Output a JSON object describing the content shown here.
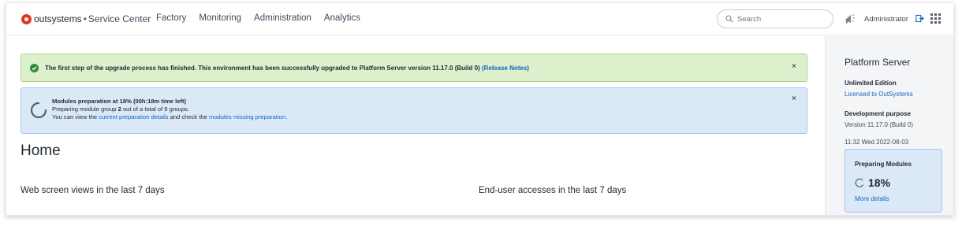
{
  "header": {
    "brand": "outsystems",
    "separator": "•",
    "app_name": "Service Center",
    "nav": [
      {
        "label": "Factory"
      },
      {
        "label": "Monitoring"
      },
      {
        "label": "Administration"
      },
      {
        "label": "Analytics"
      }
    ],
    "search": {
      "placeholder": "Search",
      "value": ""
    },
    "user": "Administrator",
    "icons": {
      "megaphone": "megaphone-icon",
      "logout": "logout-icon",
      "apps": "apps-grid-icon",
      "search": "search-icon"
    }
  },
  "alerts": {
    "success": {
      "message": "The first step of the upgrade process has finished. This environment has been successfully upgraded to Platform Server version 11.17.0 (Build 0)",
      "link": "(Release Notes)",
      "close": "×"
    },
    "info": {
      "title": "Modules preparation at 18% (00h:18m time left)",
      "line2_prefix": "Preparing module group ",
      "line2_group": "2",
      "line2_suffix": " out of a total of 9 groups.",
      "line3_prefix": "You can view the ",
      "line3_link1": "current preparation details",
      "line3_mid": " and check the ",
      "line3_link2": "modules missing preparation.",
      "close": "×"
    }
  },
  "main": {
    "title": "Home",
    "section_left": "Web screen views in the last 7 days",
    "section_right": "End-user accesses in the last 7 days"
  },
  "side": {
    "heading": "Platform Server",
    "edition": "Unlimited Edition",
    "licensed": "Licensed to OutSystems",
    "purpose": "Development purpose",
    "version": "Version 11.17.0 (Build 0)",
    "datetime": "11:32 Wed 2022-08-03",
    "prep_card": {
      "title": "Preparing Modules",
      "percent": "18%",
      "progress": 0.18,
      "link": "More details"
    }
  },
  "colors": {
    "brand_red": "#e2341d",
    "success_bg": "#dcf0cc",
    "info_bg": "#dbe8f8",
    "link": "#1765c0"
  }
}
